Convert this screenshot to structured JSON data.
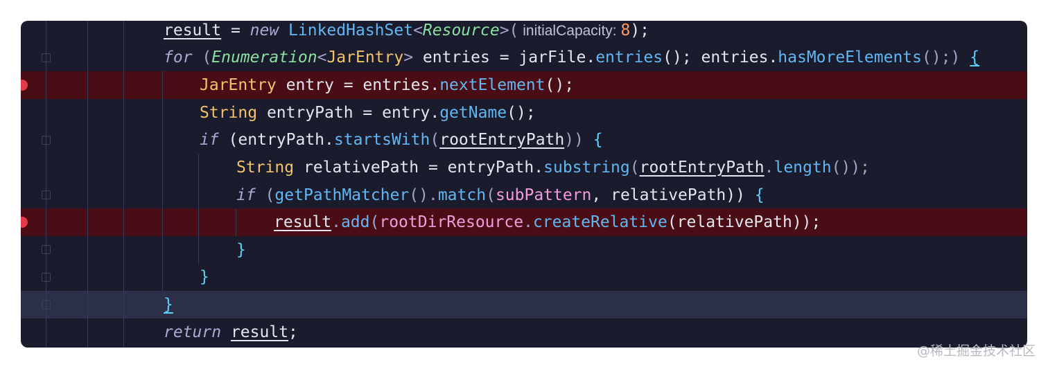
{
  "watermark": "@稀土掘金技术社区",
  "code": {
    "line1": {
      "result": "result",
      "eq": " = ",
      "kw_new": "new",
      "sp": " ",
      "cls": "LinkedHashSet",
      "lt": "<",
      "generic": "Resource",
      "gt": ">(",
      "hint": " initialCapacity: ",
      "num": "8",
      "end": ");"
    },
    "line2": {
      "kw_for": "for",
      "open": " (",
      "enum": "Enumeration",
      "lt": "<",
      "jar": "JarEntry",
      "gt": ">",
      "mid": " entries = jarFile.",
      "entries_fn": "entries",
      "mid2": "(); entries.",
      "has_fn": "hasMoreElements",
      "end": "();) ",
      "brace": "{"
    },
    "line3": {
      "type": "JarEntry",
      "mid": " entry = entries.",
      "fn": "nextElement",
      "end": "();"
    },
    "line4": {
      "type": "String",
      "mid": " entryPath = entry.",
      "fn": "getName",
      "end": "();"
    },
    "line5": {
      "kw_if": "if",
      "open": " (entryPath.",
      "fn": "startsWith",
      "paren": "(",
      "arg": "rootEntryPath",
      "end": ")) ",
      "brace": "{"
    },
    "line6": {
      "type": "String",
      "mid": " relativePath = entryPath.",
      "fn": "substring",
      "paren": "(",
      "arg": "rootEntryPath",
      "dot": ".",
      "fn2": "length",
      "end": "());"
    },
    "line7": {
      "kw_if": "if",
      "open": " (",
      "fn": "getPathMatcher",
      "mid": "().",
      "fn2": "match",
      "paren": "(",
      "field": "subPattern",
      "rest": ", relativePath)) ",
      "brace": "{"
    },
    "line8": {
      "result": "result",
      "dot": ".",
      "fn": "add",
      "paren": "(",
      "field": "rootDirResource",
      "dot2": ".",
      "fn2": "createRelative",
      "end": "(relativePath));"
    },
    "line9": {
      "brace": "}"
    },
    "line10": {
      "brace": "}"
    },
    "line11": {
      "brace": "}"
    },
    "line12": {
      "kw_return": "return",
      "sp": " ",
      "result": "result",
      "end": ";"
    }
  }
}
